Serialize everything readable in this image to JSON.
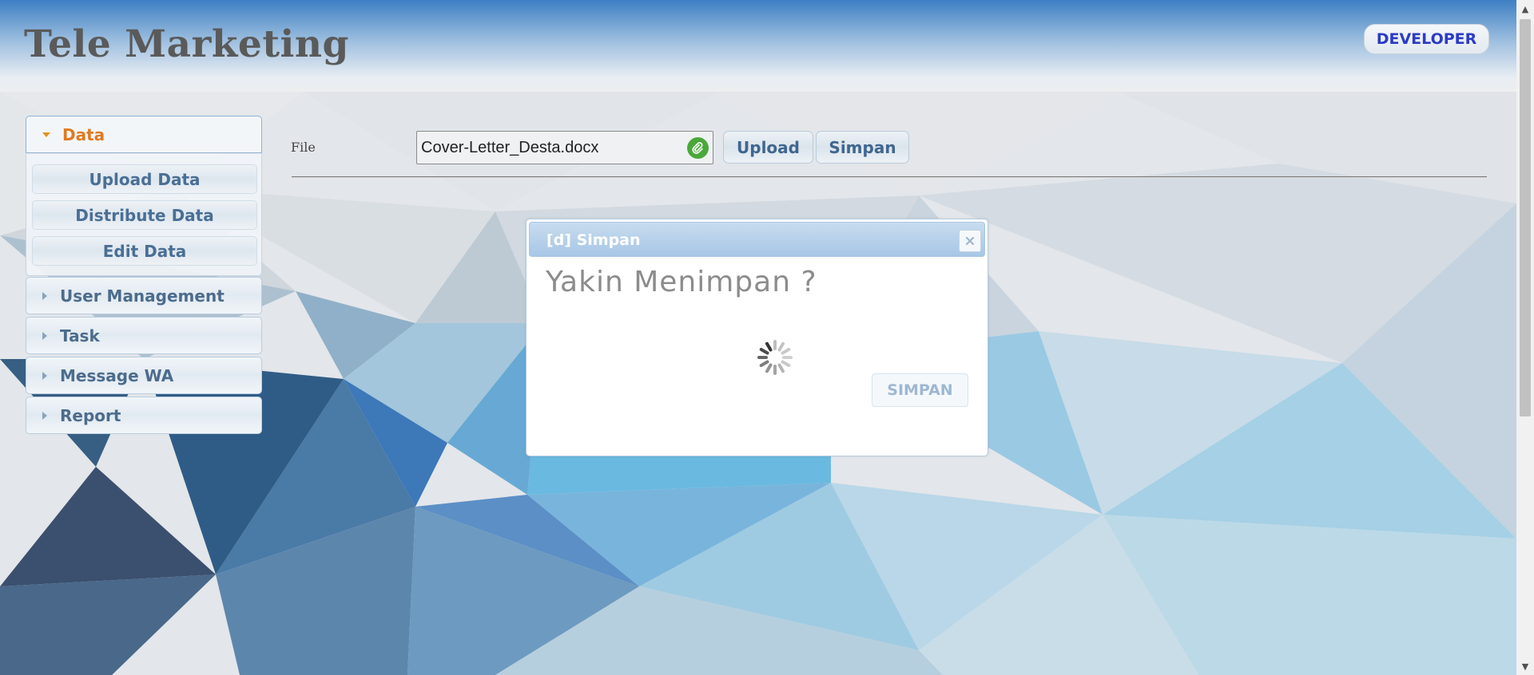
{
  "header": {
    "title": "Tele Marketing",
    "user_button": "DEVELOPER"
  },
  "sidebar": {
    "sections": [
      {
        "label": "Data",
        "expanded": true,
        "items": [
          "Upload Data",
          "Distribute Data",
          "Edit Data"
        ]
      },
      {
        "label": "User Management",
        "expanded": false
      },
      {
        "label": "Task",
        "expanded": false
      },
      {
        "label": "Message WA",
        "expanded": false
      },
      {
        "label": "Report",
        "expanded": false
      }
    ]
  },
  "form": {
    "file_label": "File",
    "file_value": "Cover-Letter_Desta.docx",
    "upload_button": "Upload",
    "save_button": "Simpan"
  },
  "dialog": {
    "title": "[d] Simpan",
    "message": "Yakin Menimpan ?",
    "save_button": "SIMPAN",
    "close_icon": "close-icon",
    "loading": true
  },
  "colors": {
    "accent_orange": "#e07a22",
    "link_blue": "#2b3bc6",
    "dialog_title_bg": "#a7c6e6"
  }
}
